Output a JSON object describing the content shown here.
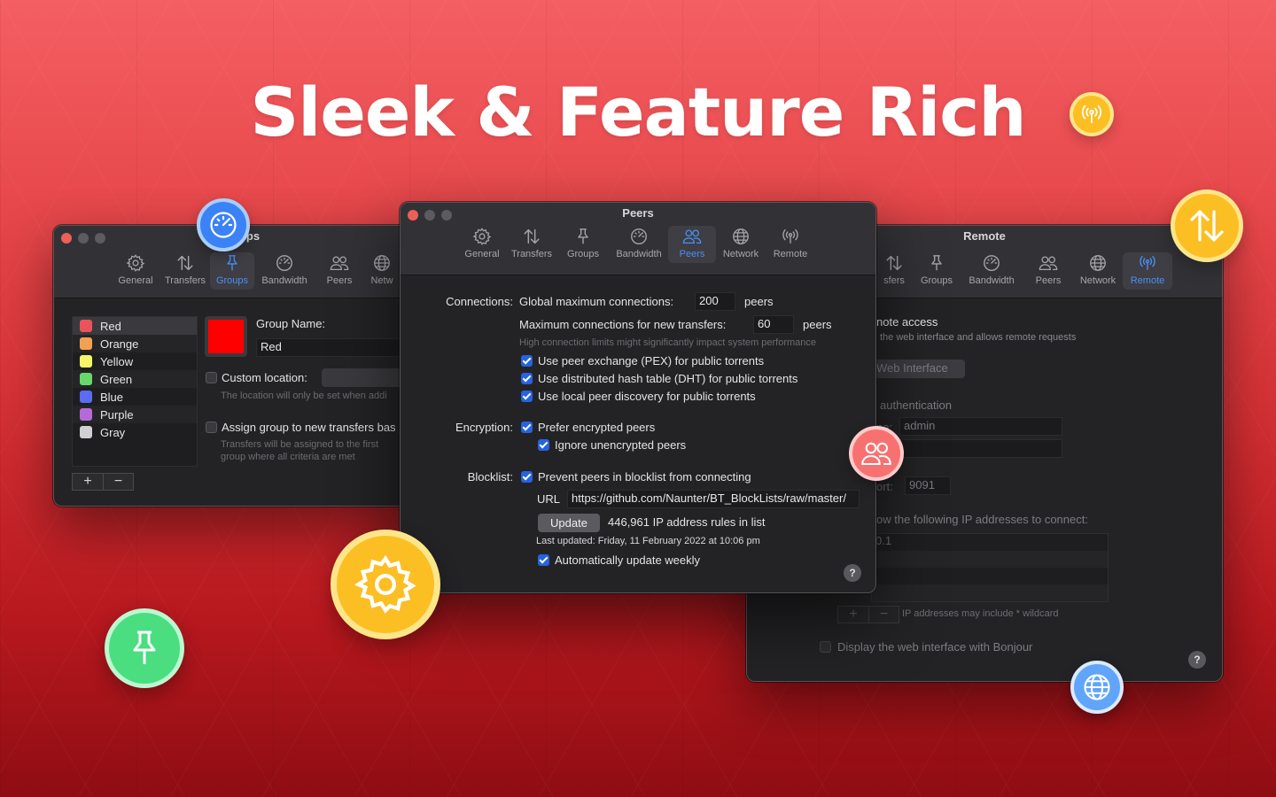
{
  "headline": "Sleek & Feature Rich",
  "tabs": {
    "general": "General",
    "transfers": "Transfers",
    "groups": "Groups",
    "bandwidth": "Bandwidth",
    "peers": "Peers",
    "network": "Network",
    "remote": "Remote"
  },
  "groups_window": {
    "title": "Groups",
    "network_partial": "Netw",
    "groups": [
      {
        "name": "Red",
        "color": "#e8545a"
      },
      {
        "name": "Orange",
        "color": "#f2a152"
      },
      {
        "name": "Yellow",
        "color": "#f5f56a"
      },
      {
        "name": "Green",
        "color": "#66d96a"
      },
      {
        "name": "Blue",
        "color": "#5a6cf0"
      },
      {
        "name": "Purple",
        "color": "#b66ad8"
      },
      {
        "name": "Gray",
        "color": "#d0d0d4"
      }
    ],
    "add_label": "+",
    "remove_label": "−",
    "selected_color": "#ff0000",
    "group_name_label": "Group Name:",
    "group_name_value": "Red",
    "custom_location_label": "Custom location:",
    "custom_location_hint": "The location will only be set when addi",
    "assign_label": "Assign group to new transfers bas",
    "assign_hint_1": "Transfers will be assigned to the first",
    "assign_hint_2": "group where all criteria are met"
  },
  "peers_window": {
    "title": "Peers",
    "connections_label": "Connections:",
    "global_max_label": "Global maximum connections:",
    "global_max_value": "200",
    "peers_unit": "peers",
    "new_max_label": "Maximum connections for new transfers:",
    "new_max_value": "60",
    "limits_hint": "High connection limits might significantly impact system performance",
    "pex_label": "Use peer exchange (PEX) for public torrents",
    "dht_label": "Use distributed hash table (DHT) for public torrents",
    "lpd_label": "Use local peer discovery for public torrents",
    "encryption_label": "Encryption:",
    "prefer_encrypted": "Prefer encrypted peers",
    "ignore_unencrypted": "Ignore unencrypted peers",
    "blocklist_label": "Blocklist:",
    "prevent_label": "Prevent peers in blocklist from connecting",
    "url_label": "URL",
    "url_value": "https://github.com/Naunter/BT_BlockLists/raw/master/",
    "update_button": "Update",
    "rules_count": "446,961 IP address rules in list",
    "last_updated": "Last updated: Friday, 11 February 2022 at 10:06 pm",
    "auto_update": "Automatically update weekly",
    "help": "?"
  },
  "remote_window": {
    "title": "Remote",
    "transfers_partial": "sfers",
    "remote_access_partial": "note access",
    "remote_hint_partial": "the web interface and allows remote requests",
    "web_interface_button_partial": "Web Interface",
    "auth_partial": "authentication",
    "username_label_partial": "ne:",
    "username_value": "admin",
    "port_label_partial": "ort:",
    "port_value": "9091",
    "allow_partial": "ow the following IP addresses to connect:",
    "ip_partial": "0.1",
    "add_label": "+",
    "remove_label": "−",
    "wildcard_hint": "IP addresses may include * wildcard",
    "bonjour_label": "Display the web interface with Bonjour",
    "help": "?"
  },
  "badges": [
    {
      "name": "bandwidth-badge",
      "icon": "speedometer-icon",
      "color": "#3b82f6"
    },
    {
      "name": "remote-badge",
      "icon": "antenna-icon",
      "color": "#fbbf24"
    },
    {
      "name": "transfers-badge",
      "icon": "arrows-updown-icon",
      "color": "#fbbf24"
    },
    {
      "name": "peers-badge",
      "icon": "people-icon",
      "color": "#f87171"
    },
    {
      "name": "general-badge",
      "icon": "gear-icon",
      "color": "#fbbf24"
    },
    {
      "name": "groups-badge",
      "icon": "pin-icon",
      "color": "#4ade80"
    },
    {
      "name": "network-badge",
      "icon": "globe-icon",
      "color": "#60a5fa"
    }
  ]
}
